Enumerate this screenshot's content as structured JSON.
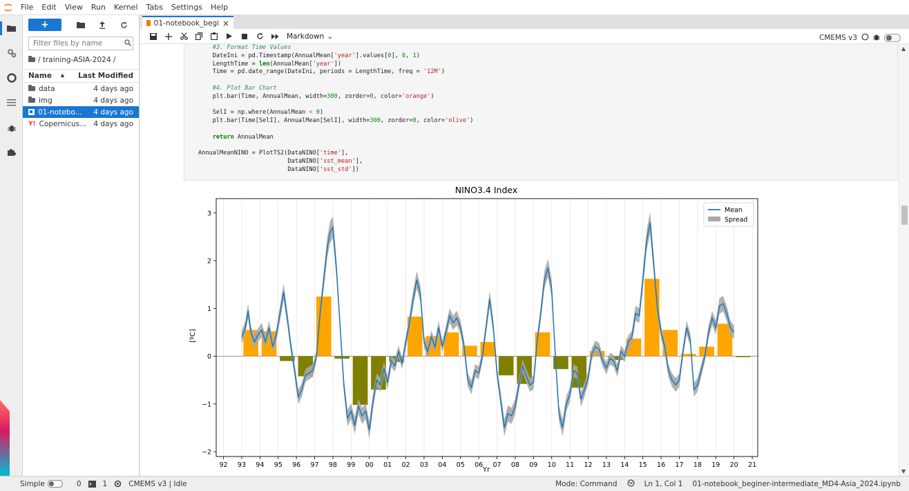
{
  "menu": [
    "File",
    "Edit",
    "View",
    "Run",
    "Kernel",
    "Tabs",
    "Settings",
    "Help"
  ],
  "rail": {
    "icons": [
      "folder-icon",
      "running-icon",
      "circle-stop-icon",
      "toc-icon",
      "debugger-icon",
      "extension-icon"
    ]
  },
  "filebrowser": {
    "new_label": "+",
    "filter_placeholder": "Filter files by name",
    "breadcrumb": "/ training-ASIA-2024 /",
    "col_name": "Name",
    "col_modified": "Last Modified",
    "rows": [
      {
        "name": "data",
        "modified": "4 days ago",
        "type": "folder"
      },
      {
        "name": "img",
        "modified": "4 days ago",
        "type": "folder"
      },
      {
        "name": "01-notebo...",
        "modified": "4 days ago",
        "type": "notebook"
      },
      {
        "name": "Copernicus...",
        "modified": "4 days ago",
        "type": "yml"
      }
    ]
  },
  "tab": {
    "label": "01-notebook_beginer-interm",
    "close": "×"
  },
  "toolbar": {
    "cell_type": "Markdown",
    "kernel_name": "CMEMS v3"
  },
  "code": {
    "lines": [
      {
        "indent": "    ",
        "parts": [
          {
            "t": "c",
            "s": "#3. Format Time Values"
          }
        ]
      },
      {
        "indent": "    ",
        "parts": [
          {
            "t": "n",
            "s": "DateIni = pd.Timestamp(AnnualMean["
          },
          {
            "t": "s",
            "s": "'year'"
          },
          {
            "t": "n",
            "s": "].values["
          },
          {
            "t": "d",
            "s": "0"
          },
          {
            "t": "n",
            "s": "], "
          },
          {
            "t": "d",
            "s": "6"
          },
          {
            "t": "n",
            "s": ", "
          },
          {
            "t": "d",
            "s": "1"
          },
          {
            "t": "n",
            "s": ")"
          }
        ]
      },
      {
        "indent": "    ",
        "parts": [
          {
            "t": "n",
            "s": "LengthTime = "
          },
          {
            "t": "k",
            "s": "len"
          },
          {
            "t": "n",
            "s": "(AnnualMean["
          },
          {
            "t": "s",
            "s": "'year'"
          },
          {
            "t": "n",
            "s": "])"
          }
        ]
      },
      {
        "indent": "    ",
        "parts": [
          {
            "t": "n",
            "s": "Time = pd.date_range(DateIni, periods = LengthTime, freq = "
          },
          {
            "t": "s",
            "s": "'12M'"
          },
          {
            "t": "n",
            "s": ")"
          }
        ]
      },
      {
        "indent": "",
        "parts": []
      },
      {
        "indent": "    ",
        "parts": [
          {
            "t": "c",
            "s": "#4. Plot Bar Chart"
          }
        ]
      },
      {
        "indent": "    ",
        "parts": [
          {
            "t": "n",
            "s": "plt.bar(Time, AnnualMean, width="
          },
          {
            "t": "d",
            "s": "300"
          },
          {
            "t": "n",
            "s": ", zorder="
          },
          {
            "t": "d",
            "s": "0"
          },
          {
            "t": "n",
            "s": ", color="
          },
          {
            "t": "s",
            "s": "'orange'"
          },
          {
            "t": "n",
            "s": ")"
          }
        ]
      },
      {
        "indent": "",
        "parts": []
      },
      {
        "indent": "    ",
        "parts": [
          {
            "t": "n",
            "s": "SelI = np.where(AnnualMean "
          },
          {
            "t": "o",
            "s": "<"
          },
          {
            "t": "n",
            "s": " "
          },
          {
            "t": "d",
            "s": "0"
          },
          {
            "t": "n",
            "s": ")"
          }
        ]
      },
      {
        "indent": "    ",
        "parts": [
          {
            "t": "n",
            "s": "plt.bar(Time[SelI], AnnualMean[SelI], width="
          },
          {
            "t": "d",
            "s": "300"
          },
          {
            "t": "n",
            "s": ", zorder="
          },
          {
            "t": "d",
            "s": "0"
          },
          {
            "t": "n",
            "s": ", color="
          },
          {
            "t": "s",
            "s": "'olive'"
          },
          {
            "t": "n",
            "s": ")"
          }
        ]
      },
      {
        "indent": "",
        "parts": []
      },
      {
        "indent": "    ",
        "parts": [
          {
            "t": "k",
            "s": "return"
          },
          {
            "t": "n",
            "s": " AnnualMean"
          }
        ]
      },
      {
        "indent": "",
        "parts": []
      },
      {
        "indent": "",
        "parts": [
          {
            "t": "n",
            "s": "AnnualMeanNINO = PlotTS2(DataNINO["
          },
          {
            "t": "s",
            "s": "'time'"
          },
          {
            "t": "n",
            "s": "],"
          }
        ]
      },
      {
        "indent": "                         ",
        "parts": [
          {
            "t": "n",
            "s": "DataNINO["
          },
          {
            "t": "s",
            "s": "'sst_mean'"
          },
          {
            "t": "n",
            "s": "],"
          }
        ]
      },
      {
        "indent": "                         ",
        "parts": [
          {
            "t": "n",
            "s": "DataNINO["
          },
          {
            "t": "s",
            "s": "'sst_std'"
          },
          {
            "t": "n",
            "s": "])"
          }
        ]
      }
    ]
  },
  "chart_data": {
    "type": "bar",
    "title": "NINO3.4 Index",
    "xlabel": "Yr",
    "ylabel": "[ºC]",
    "xlim": [
      1991.6,
      2021.3
    ],
    "ylim": [
      -2.1,
      3.3
    ],
    "xticks": [
      "92",
      "93",
      "94",
      "95",
      "96",
      "97",
      "98",
      "99",
      "00",
      "01",
      "02",
      "03",
      "04",
      "05",
      "06",
      "07",
      "08",
      "09",
      "10",
      "11",
      "12",
      "13",
      "14",
      "15",
      "16",
      "17",
      "18",
      "19",
      "20",
      "21"
    ],
    "yticks": [
      -2,
      -1,
      0,
      1,
      2,
      3
    ],
    "legend": {
      "position": "top-right",
      "entries": [
        "Mean",
        "Spread"
      ]
    },
    "grid": "vertical",
    "bars": {
      "years": [
        1993,
        1994,
        1995,
        1996,
        1997,
        1998,
        1999,
        2000,
        2001,
        2002,
        2003,
        2004,
        2005,
        2006,
        2007,
        2008,
        2009,
        2010,
        2011,
        2012,
        2013,
        2014,
        2015,
        2016,
        2017,
        2018,
        2019,
        2020
      ],
      "values": [
        0.55,
        0.52,
        -0.1,
        -0.42,
        1.25,
        -0.05,
        -1.02,
        -0.7,
        -0.12,
        0.83,
        0.42,
        0.5,
        0.22,
        0.3,
        -0.4,
        -0.58,
        0.5,
        -0.27,
        -0.66,
        0.11,
        -0.08,
        0.37,
        1.62,
        0.55,
        0.05,
        0.2,
        0.68,
        -0.02
      ],
      "colors": {
        "positive": "#ffa500",
        "negative": "#808000"
      }
    },
    "series": [
      {
        "name": "Mean",
        "color": "#1f77b4",
        "x": [
          1993.0,
          1993.2,
          1993.35,
          1993.5,
          1993.7,
          1993.9,
          1994.1,
          1994.3,
          1994.5,
          1994.7,
          1994.9,
          1995.1,
          1995.3,
          1995.5,
          1995.7,
          1995.9,
          1996.1,
          1996.3,
          1996.5,
          1996.7,
          1996.9,
          1997.1,
          1997.3,
          1997.5,
          1997.7,
          1997.85,
          1998.0,
          1998.2,
          1998.4,
          1998.6,
          1998.8,
          1999.0,
          1999.2,
          1999.4,
          1999.6,
          1999.8,
          2000.0,
          2000.2,
          2000.4,
          2000.6,
          2000.8,
          2001.0,
          2001.2,
          2001.4,
          2001.6,
          2001.8,
          2002.0,
          2002.2,
          2002.4,
          2002.6,
          2002.8,
          2003.0,
          2003.2,
          2003.4,
          2003.6,
          2003.8,
          2004.0,
          2004.2,
          2004.4,
          2004.6,
          2004.8,
          2005.0,
          2005.2,
          2005.4,
          2005.6,
          2005.8,
          2006.0,
          2006.2,
          2006.4,
          2006.6,
          2006.8,
          2007.0,
          2007.2,
          2007.4,
          2007.6,
          2007.8,
          2008.0,
          2008.2,
          2008.4,
          2008.6,
          2008.8,
          2009.0,
          2009.2,
          2009.4,
          2009.6,
          2009.8,
          2010.0,
          2010.2,
          2010.4,
          2010.6,
          2010.8,
          2011.0,
          2011.2,
          2011.4,
          2011.6,
          2011.8,
          2012.0,
          2012.2,
          2012.4,
          2012.6,
          2012.8,
          2013.0,
          2013.2,
          2013.4,
          2013.6,
          2013.8,
          2014.0,
          2014.2,
          2014.4,
          2014.6,
          2014.8,
          2015.0,
          2015.2,
          2015.4,
          2015.6,
          2015.8,
          2016.0,
          2016.2,
          2016.4,
          2016.6,
          2016.8,
          2017.0,
          2017.2,
          2017.4,
          2017.6,
          2017.8,
          2018.0,
          2018.2,
          2018.4,
          2018.6,
          2018.8,
          2019.0,
          2019.2,
          2019.4,
          2019.6,
          2019.8,
          2020.0
        ],
        "y": [
          0.4,
          0.6,
          0.95,
          0.5,
          0.3,
          0.45,
          0.55,
          0.3,
          0.6,
          0.2,
          0.45,
          0.9,
          1.35,
          0.8,
          0.2,
          -0.3,
          -0.85,
          -0.7,
          -0.4,
          -0.35,
          -0.3,
          0.0,
          0.9,
          1.6,
          2.3,
          2.6,
          2.7,
          1.8,
          0.6,
          -0.6,
          -1.3,
          -1.15,
          -1.45,
          -1.05,
          -1.25,
          -1.15,
          -1.55,
          -0.95,
          -0.5,
          -0.6,
          -0.25,
          -0.55,
          -0.1,
          -0.2,
          0.1,
          -0.15,
          0.3,
          0.7,
          1.2,
          1.6,
          1.3,
          0.3,
          0.1,
          0.4,
          0.2,
          0.6,
          0.2,
          0.5,
          0.85,
          0.7,
          0.8,
          0.6,
          0.2,
          -0.5,
          -0.65,
          -0.3,
          -0.35,
          0.0,
          0.6,
          1.2,
          0.6,
          -0.35,
          -0.9,
          -1.5,
          -1.2,
          -1.25,
          -1.05,
          -0.6,
          -0.2,
          -0.4,
          -0.6,
          -0.55,
          0.3,
          0.9,
          1.6,
          1.85,
          1.4,
          0.0,
          -1.2,
          -1.5,
          -1.0,
          -0.8,
          -0.3,
          -0.35,
          -0.9,
          -0.7,
          -0.45,
          0.05,
          0.2,
          0.15,
          -0.1,
          -0.25,
          -0.05,
          -0.1,
          -0.3,
          0.1,
          0.0,
          0.3,
          0.4,
          0.9,
          0.85,
          1.6,
          2.4,
          2.8,
          1.9,
          1.0,
          0.5,
          0.2,
          -0.3,
          -0.5,
          -0.6,
          -0.5,
          0.1,
          0.6,
          0.35,
          -0.7,
          -0.6,
          -0.3,
          0.0,
          0.5,
          0.8,
          0.6,
          1.05,
          1.1,
          0.9,
          0.6,
          0.5
        ]
      }
    ]
  }
}
